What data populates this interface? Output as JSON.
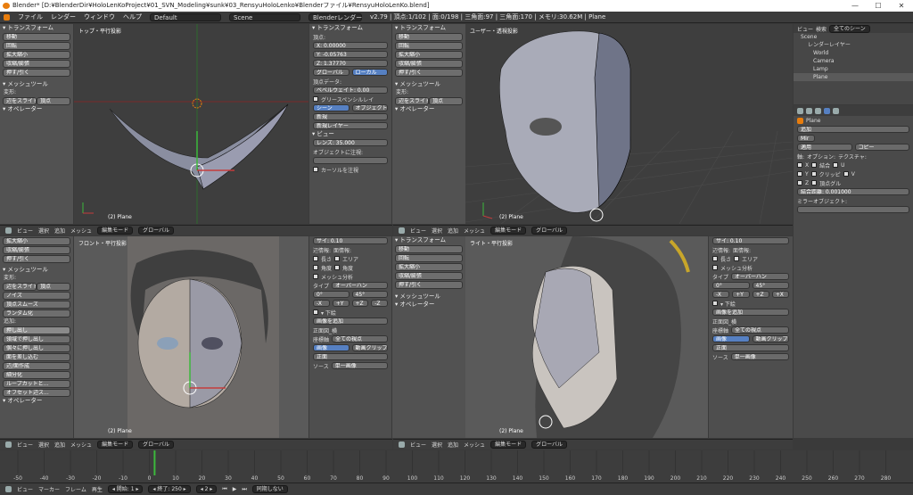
{
  "title_bar": {
    "text": "Blender* [D:¥BlenderDir¥HoloLenKoProject¥01_SVN_Modeling¥sunk¥03_RensyuHoloLenko¥Blenderファイル¥RensyuHoloLenKo.blend]",
    "minimize": "—",
    "maximize": "☐",
    "close": "✕"
  },
  "menu": {
    "items": [
      "ファイル",
      "レンダー",
      "ウィンドウ",
      "ヘルプ"
    ],
    "layout": "Default",
    "scene": "Scene",
    "engine": "Blenderレンダー",
    "stats": "v2.79 | 頂点:1/102 | 面:0/198 | 三角面:97 | 三角面:170 | メモリ:30.62M | Plane"
  },
  "tool_panel_top": {
    "section_transform": "▾ トランスフォーム",
    "buttons": [
      "移動",
      "回転",
      "拡大縮小",
      "収縮/膨張",
      "押す/引く"
    ],
    "section_mesh": "▾ メッシュツール",
    "deform_label": "変形:",
    "row": [
      "辺をスライド",
      "頂点"
    ],
    "operator": "▾ オペレーター"
  },
  "tool_panel_bottom": {
    "buttons_top": [
      "拡大縮小",
      "収縮/膨張",
      "押す/引く"
    ],
    "section_mesh": "▾ メッシュツール",
    "deform_label": "変形:",
    "row": [
      "辺をスライド",
      "頂点"
    ],
    "buttons_mid": [
      "ノイズ",
      "頂点スムーズ",
      "ランダム化"
    ],
    "add_label": "追加:",
    "buttons_add": [
      "押し出し",
      "領域で押し出し",
      "個々に押し出し",
      "面を差し込む",
      "辺/面作成",
      "細分化",
      "ループカットと...",
      "オフセット辺ス..."
    ],
    "operator": "▾ オペレーター"
  },
  "viewports": {
    "top_left": {
      "label": "トップ・平行投影",
      "object": "(2) Plane"
    },
    "top_right": {
      "label": "ユーザー・透視投影",
      "object": "(2) Plane"
    },
    "bottom_left": {
      "label": "フロント・平行投影",
      "object": "(2) Plane"
    },
    "bottom_right": {
      "label": "ライト・平行投影",
      "object": "(2) Plane"
    }
  },
  "vp_header": {
    "items": [
      "ビュー",
      "選択",
      "追加",
      "メッシュ"
    ],
    "mode": "編集モード",
    "orientation": "グローバル"
  },
  "n_panel_top": {
    "transform": "▾ トランスフォーム",
    "vertex_label": "頂点:",
    "x": "X:   0.00000",
    "y": "Y:   -0.05763",
    "z": "Z:   1.37770",
    "global": "グローバル",
    "local": "ローカル",
    "vertex_data": "頂点データ:",
    "bevel_weight": "ベベルウェイト:   0.00",
    "grease": "グリースペンシルレイ",
    "scene": "シーン",
    "object": "オブジェクト",
    "new": "新規",
    "new_layer": "新規レイヤー",
    "view": "▾ ビュー",
    "lens": "レンズ:   35.000",
    "lock_object": "オブジェクトに注視:",
    "cursor_lock": "カーソルを注視"
  },
  "n_panel_bottom": {
    "size": "サイ: 0.10",
    "normals_label": "辺情報:",
    "face_label": "面情報:",
    "length": "長さ",
    "area": "エリア",
    "angle": "角度",
    "mesh_analysis": "メッシュ分析",
    "type": "タイプ",
    "overhang": "オーバーハン",
    "zero": "0°",
    "fortyfive": "45°",
    "axes": [
      "-X",
      "+Y",
      "+Z",
      "-Z",
      "+X"
    ],
    "background": "▾ 下絵",
    "add_image": "画像を追加",
    "front_view": "正面図_横",
    "axis_label": "座標軸",
    "all_views": "全ての視点",
    "image": "画像",
    "movie_clip": "動画クリップ",
    "front": "正面",
    "source_label": "ソース",
    "single_image": "単一画像"
  },
  "outliner": {
    "view": "ビュー",
    "search": "検索",
    "all_scenes": "全てのシーン",
    "rows": [
      "Scene",
      "レンダーレイヤー",
      "World",
      "Camera",
      "Lamp",
      "Plane"
    ]
  },
  "properties": {
    "object": "Plane",
    "add": "追加",
    "modifier": "Mir",
    "apply": "適用",
    "copy": "コピー",
    "axis_label": "軸:",
    "options_label": "オプション:",
    "texture_label": "テクスチャ:",
    "axes": [
      "X",
      "Y",
      "Z"
    ],
    "options": [
      "結合",
      "クリッピ",
      "頂点グル"
    ],
    "texture": [
      "U",
      "V"
    ],
    "merge_limit": "結合距離:   0.001000",
    "mirror_object": "ミラーオブジェクト:"
  },
  "timeline": {
    "ticks": [
      "-50",
      "-40",
      "-30",
      "-20",
      "-10",
      "0",
      "10",
      "20",
      "30",
      "40",
      "50",
      "60",
      "70",
      "80",
      "90",
      "100",
      "110",
      "120",
      "130",
      "140",
      "150",
      "160",
      "170",
      "180",
      "190",
      "200",
      "210",
      "220",
      "230",
      "240",
      "250",
      "260",
      "270",
      "280"
    ],
    "current_frame_marker": 2
  },
  "bottombar": {
    "items": [
      "ビュー",
      "マーカー",
      "フレーム",
      "再生"
    ],
    "start": "◂ 開始:   1 ▸",
    "end": "◂ 終了:   250 ▸",
    "current": "◂   2 ▸",
    "sync": "同期しない"
  },
  "colors": {
    "accent_blue": "#5680c2",
    "axis_red": "#c43c3c",
    "axis_green": "#3cb83c",
    "orange": "#e87d0d"
  }
}
